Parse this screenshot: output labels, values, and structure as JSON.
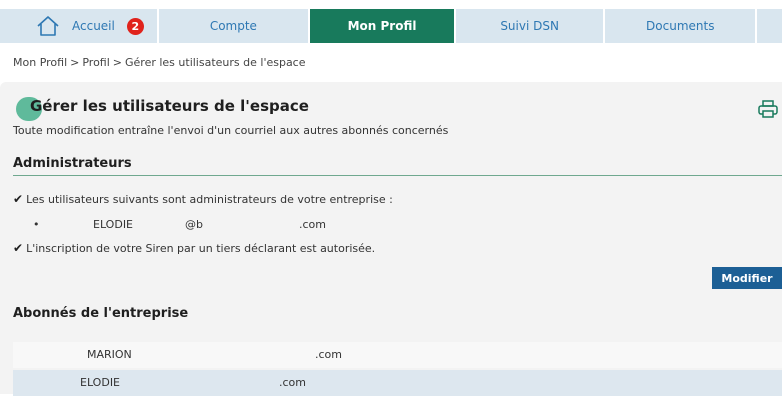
{
  "nav": {
    "tabs": [
      {
        "label": "Accueil",
        "badge": "2",
        "icon": "home-icon",
        "active": false
      },
      {
        "label": "Compte",
        "active": false
      },
      {
        "label": "Mon Profil",
        "active": true
      },
      {
        "label": "Suivi DSN",
        "active": false
      },
      {
        "label": "Documents",
        "active": false
      }
    ]
  },
  "breadcrumb": [
    "Mon Profil",
    "Profil",
    "Gérer les utilisateurs de l'espace"
  ],
  "breadcrumb_sep": ">",
  "page": {
    "title": "Gérer les utilisateurs de l'espace",
    "subtitle": "Toute modification entraîne l'envoi d'un courriel aux autres abonnés concernés",
    "print_icon": "printer-icon"
  },
  "admins": {
    "section_title": "Administrateurs",
    "intro": "Les utilisateurs suivants sont administrateurs de votre entreprise :",
    "users": [
      {
        "bullet": "•",
        "name": "ELODIE",
        "email_at": "@b",
        "email_domain": ".com"
      }
    ],
    "siren_note": "L'inscription de votre Siren par un tiers déclarant est autorisée.",
    "modify_label": "Modifier"
  },
  "subscribers": {
    "section_title": "Abonnés de l'entreprise",
    "rows": [
      {
        "name": "MARION",
        "email": ".com"
      },
      {
        "name": "ELODIE",
        "email": ".com"
      }
    ]
  },
  "colors": {
    "tab_bg": "#d9e6ef",
    "tab_active_bg": "#187a5c",
    "tab_text": "#2e78b3",
    "badge": "#e0231c",
    "button": "#1c5f95",
    "accent_green": "#5fba9b"
  }
}
